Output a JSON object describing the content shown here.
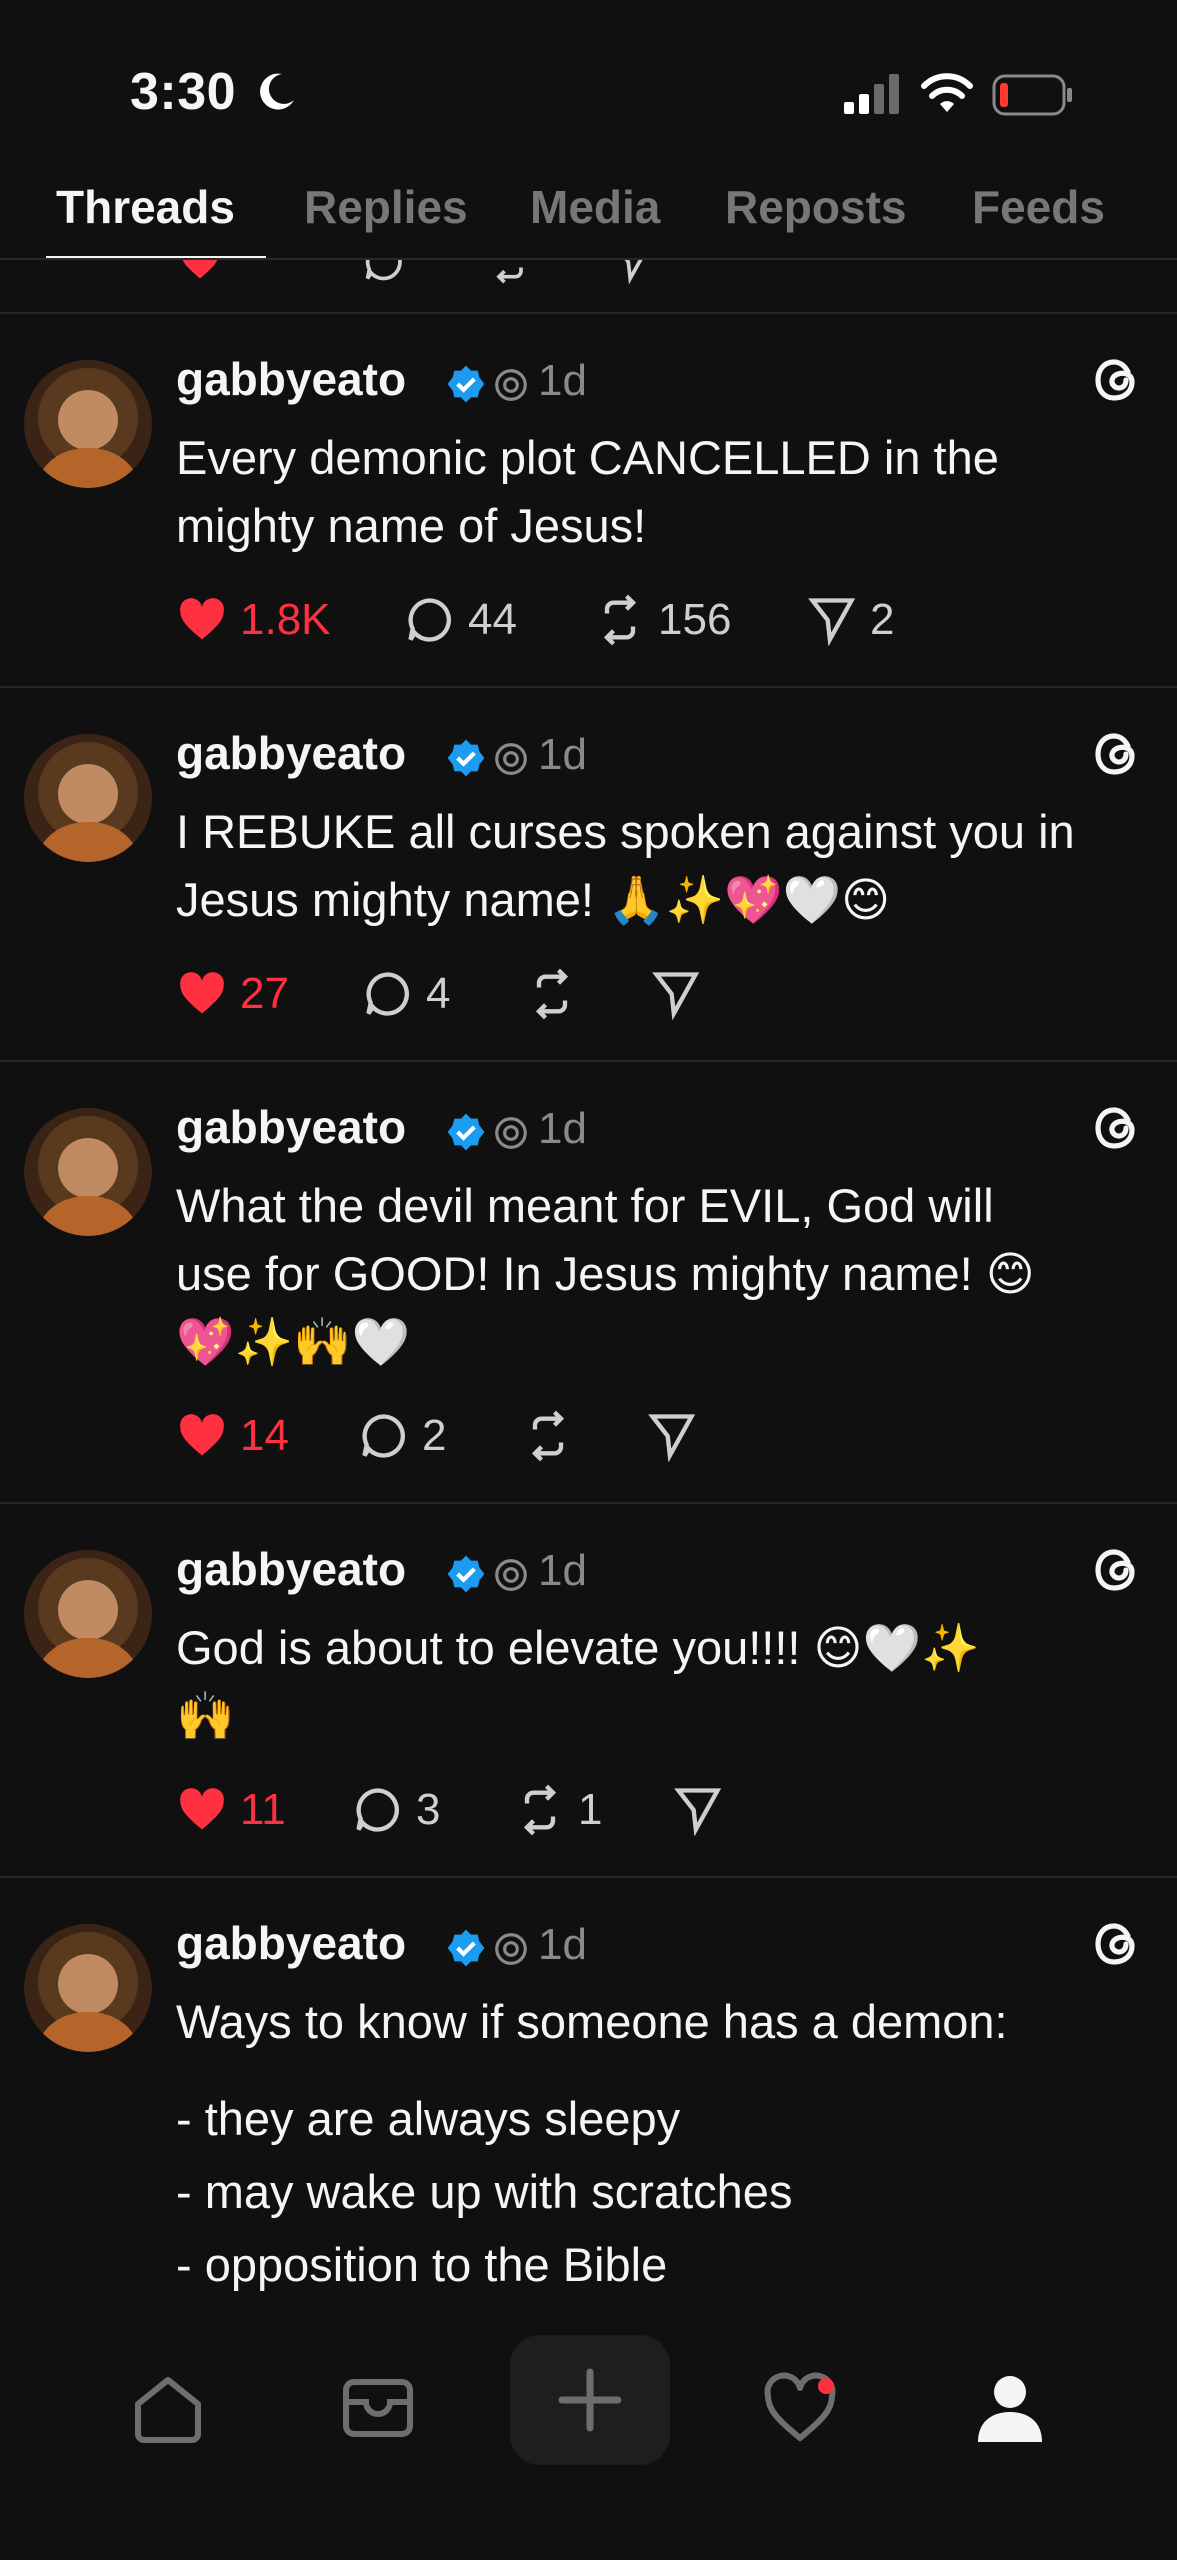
{
  "status_bar": {
    "time": "3:30",
    "icons": [
      "moon-icon",
      "cellular-signal-icon",
      "wifi-icon",
      "battery-low-icon"
    ]
  },
  "tabs": [
    {
      "label": "Threads",
      "active": true
    },
    {
      "label": "Replies",
      "active": false
    },
    {
      "label": "Media",
      "active": false
    },
    {
      "label": "Reposts",
      "active": false
    },
    {
      "label": "Feeds",
      "active": false
    }
  ],
  "posts": [
    {
      "username": "gabbyeato",
      "time_ago": "1d",
      "text_lines": [
        "Every demonic plot CANCELLED in the",
        "mighty name of Jesus!"
      ],
      "likes": "1.8K",
      "replies": "44",
      "reposts": "156",
      "shares": "2"
    },
    {
      "username": "gabbyeato",
      "time_ago": "1d",
      "text_lines": [
        "I REBUKE all curses spoken against you in",
        "Jesus mighty name! 🙏✨💖🤍😊"
      ],
      "likes": "27",
      "replies": "4",
      "reposts": "",
      "shares": ""
    },
    {
      "username": "gabbyeato",
      "time_ago": "1d",
      "text_lines": [
        "What the devil meant for EVIL, God will",
        "use for GOOD! In Jesus mighty name! 😊",
        "💖✨🙌🤍"
      ],
      "likes": "14",
      "replies": "2",
      "reposts": "",
      "shares": ""
    },
    {
      "username": "gabbyeato",
      "time_ago": "1d",
      "text_lines": [
        "God is about to elevate you!!!! 😊🤍✨",
        "🙌"
      ],
      "likes": "11",
      "replies": "3",
      "reposts": "1",
      "shares": ""
    },
    {
      "username": "gabbyeato",
      "time_ago": "1d",
      "text_lines": [
        "Ways to know if someone has a demon:"
      ],
      "list_lines": [
        "- they are always sleepy",
        "- may wake up with scratches",
        "- opposition to the Bible"
      ]
    }
  ],
  "bottom_nav": [
    "home-icon",
    "inbox-icon",
    "compose-plus-icon",
    "activity-heart-icon",
    "profile-icon"
  ],
  "colors": {
    "background": "#101010",
    "like_red": "#ff3040",
    "verified_blue": "#1d9bf0",
    "muted": "#8a8a8a"
  }
}
